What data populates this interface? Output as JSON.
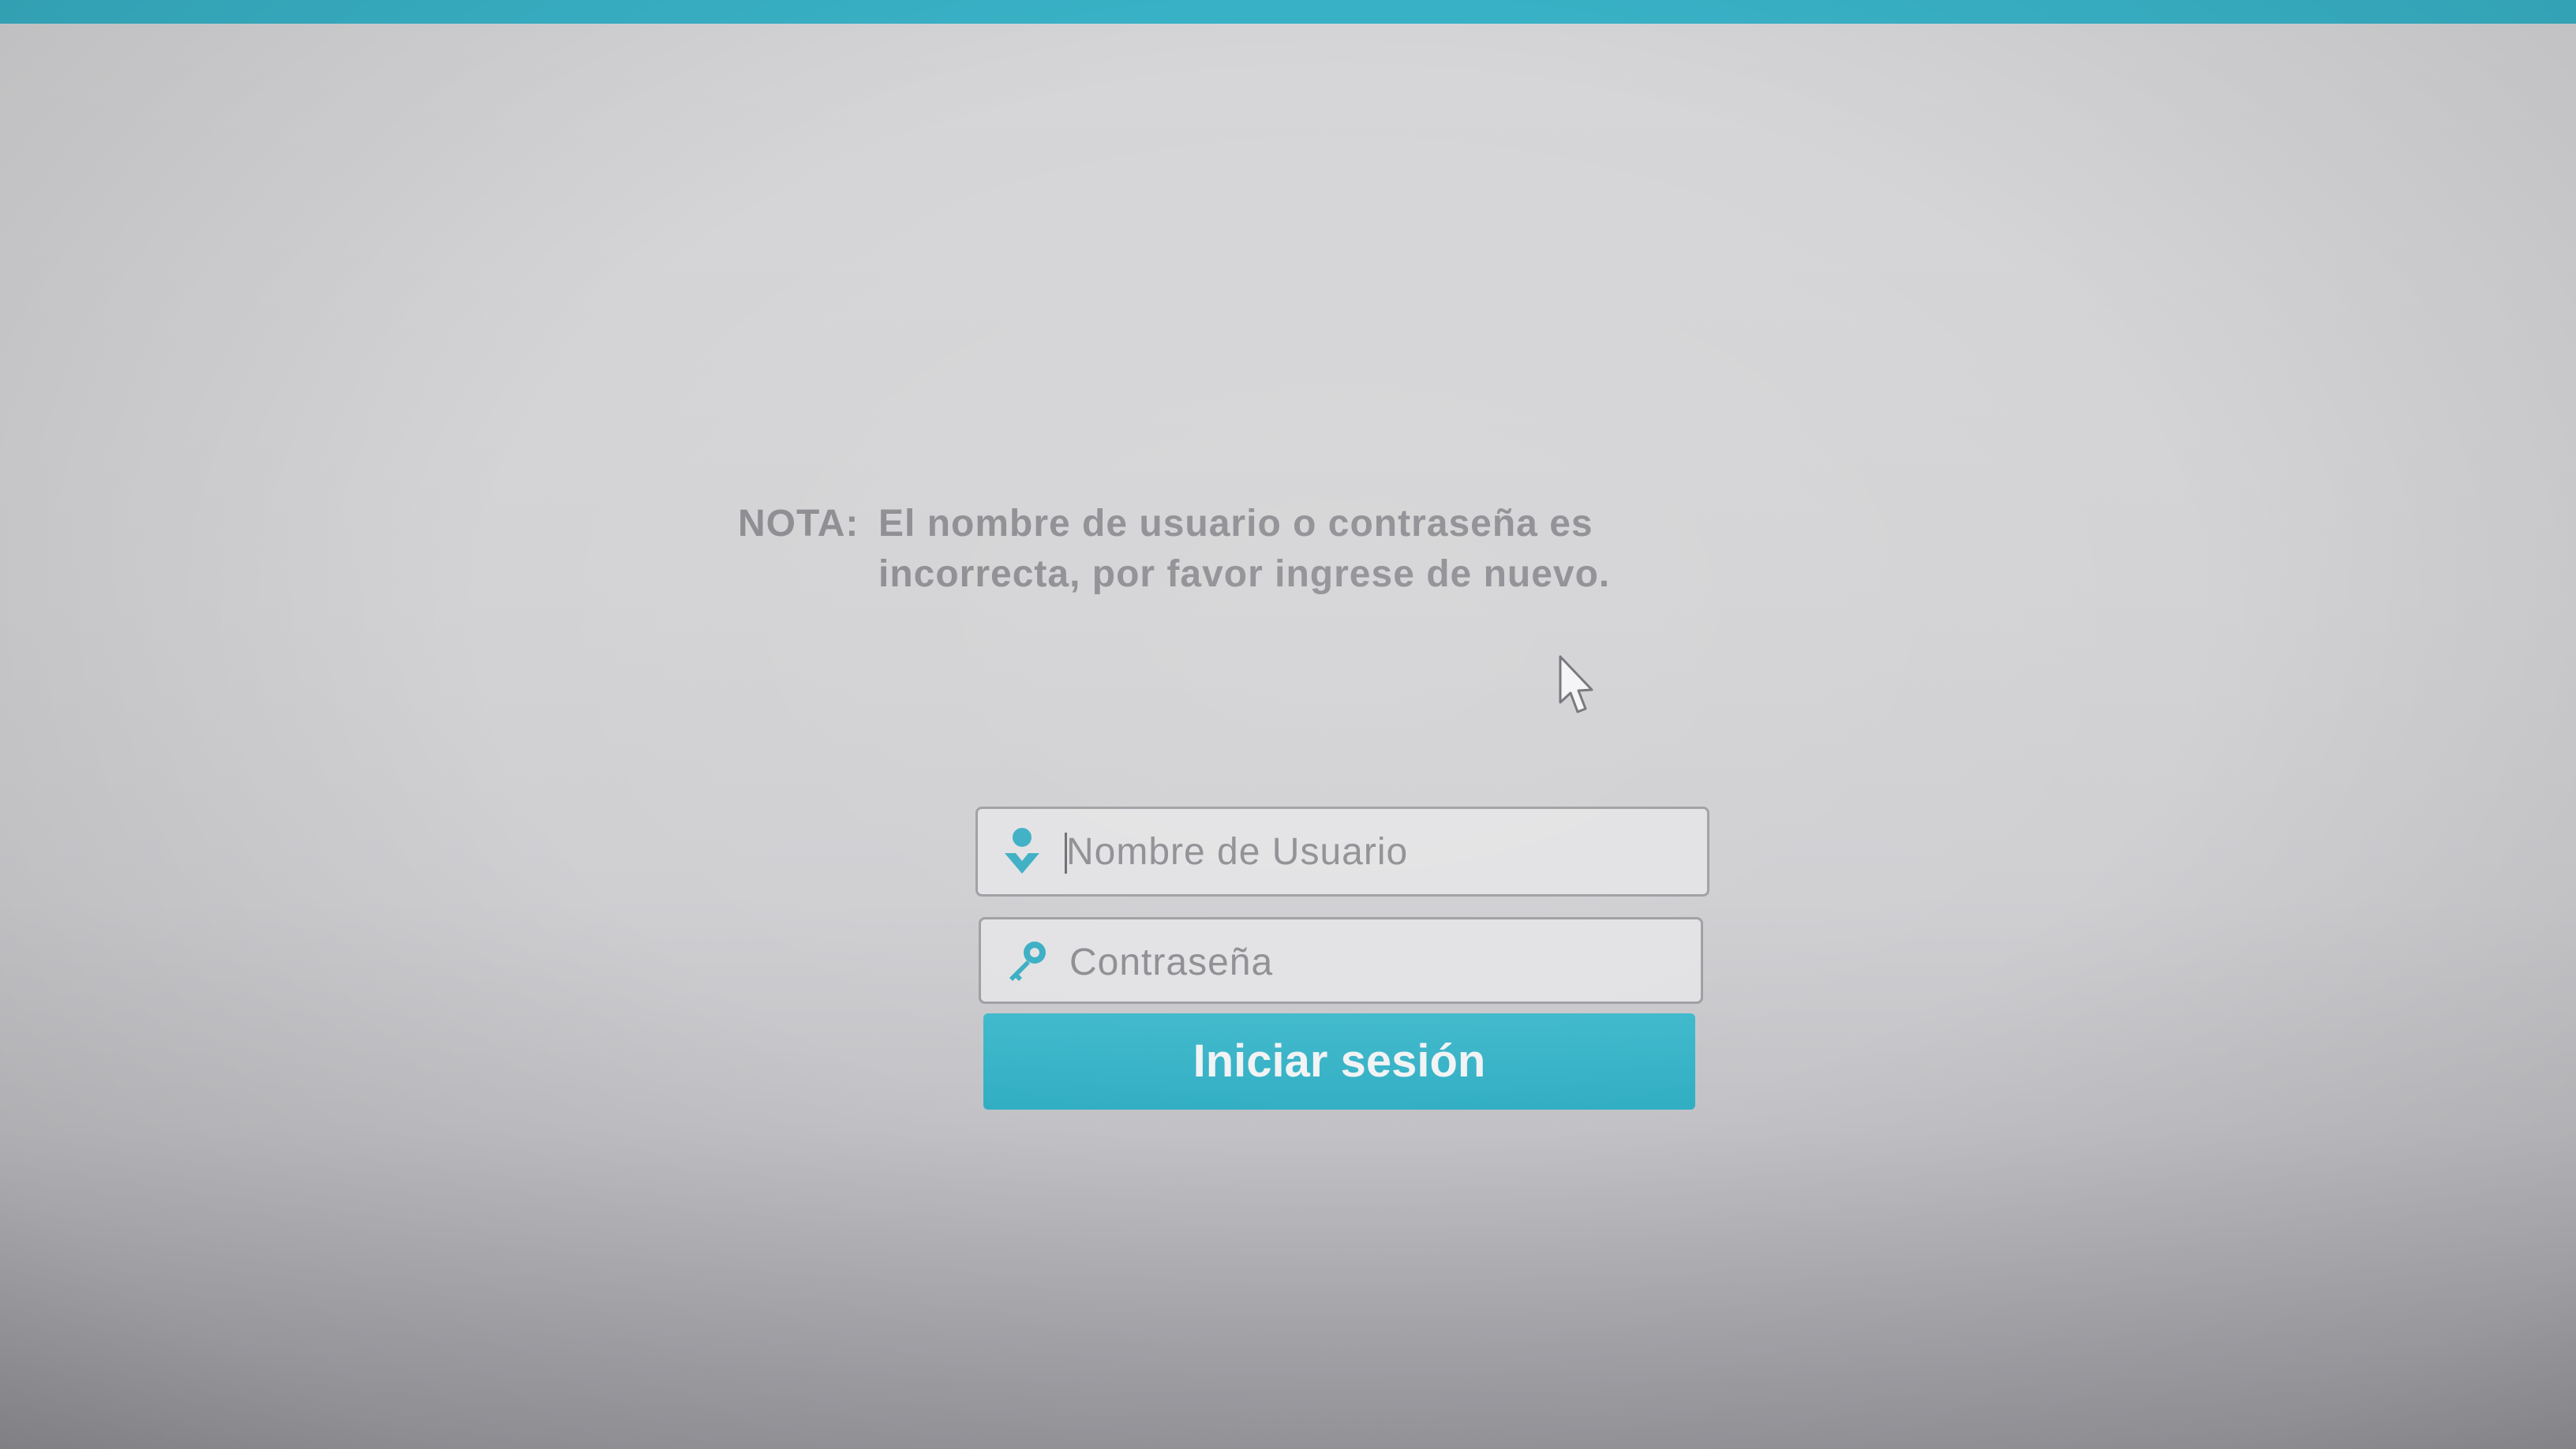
{
  "theme": {
    "accent": "#39b3c8",
    "background": "#d6d6d8",
    "text_gray": "#8b8b90",
    "button_text": "#f1f3f4"
  },
  "notice": {
    "label": "NOTA:",
    "message": "El nombre de usuario o contraseña es incorrecta, por favor ingrese de nuevo."
  },
  "login_form": {
    "username": {
      "icon": "user-icon",
      "placeholder": "Nombre de Usuario",
      "value": ""
    },
    "password": {
      "icon": "key-icon",
      "placeholder": "Contraseña",
      "value": ""
    },
    "submit_label": "Iniciar sesión"
  },
  "pointer": {
    "icon": "mouse-cursor-icon"
  }
}
